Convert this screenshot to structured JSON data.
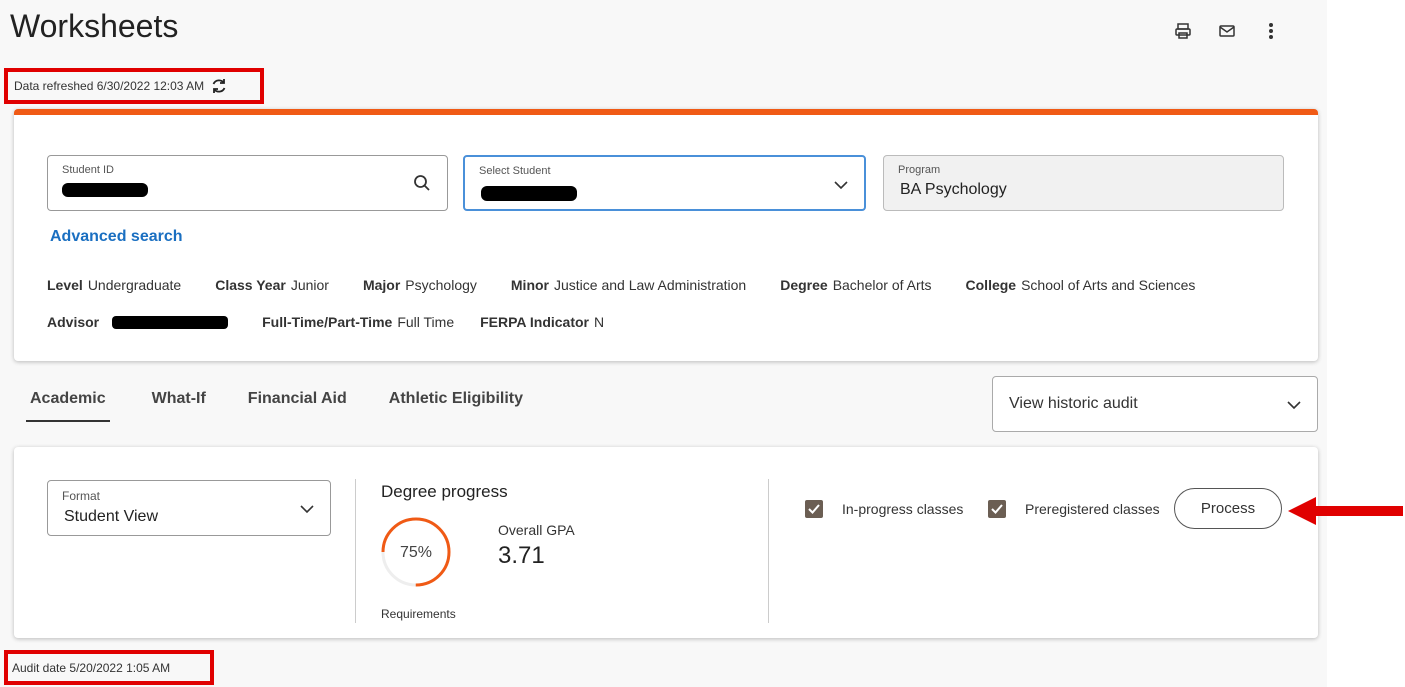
{
  "header": {
    "title": "Worksheets",
    "icons": [
      "print-icon",
      "mail-icon",
      "more-vertical-icon"
    ]
  },
  "refresh": {
    "label": "Data refreshed",
    "value": "6/30/2022 12:03 AM"
  },
  "student": {
    "id_label": "Student ID",
    "select_label": "Select Student",
    "program_label": "Program",
    "program_value": "BA Psychology",
    "advanced_search": "Advanced search",
    "accent": "#f05a15"
  },
  "info": {
    "level_label": "Level",
    "level": "Undergraduate",
    "class_year_label": "Class Year",
    "class_year": "Junior",
    "major_label": "Major",
    "major": "Psychology",
    "minor_label": "Minor",
    "minor": "Justice and Law Administration",
    "degree_label": "Degree",
    "degree": "Bachelor of Arts",
    "college_label": "College",
    "college": "School of Arts and Sciences",
    "advisor_label": "Advisor",
    "fulltime_label": "Full-Time/Part-Time",
    "fulltime": "Full Time",
    "ferpa_label": "FERPA Indicator",
    "ferpa": "N"
  },
  "tabs": [
    {
      "label": "Academic",
      "active": true
    },
    {
      "label": "What-If",
      "active": false
    },
    {
      "label": "Financial Aid",
      "active": false
    },
    {
      "label": "Athletic Eligibility",
      "active": false
    }
  ],
  "historic": {
    "label": "View historic audit"
  },
  "audit": {
    "format_label": "Format",
    "format_value": "Student View",
    "degree_progress_title": "Degree progress",
    "progress_text": "75%",
    "progress_value": 0.75,
    "requirements_label": "Requirements",
    "gpa_label": "Overall GPA",
    "gpa_value": "3.71",
    "inprogress_label": "In-progress classes",
    "preregistered_label": "Preregistered classes",
    "process_label": "Process"
  },
  "audit_date": {
    "label": "Audit date",
    "value": "5/20/2022 1:05 AM"
  }
}
